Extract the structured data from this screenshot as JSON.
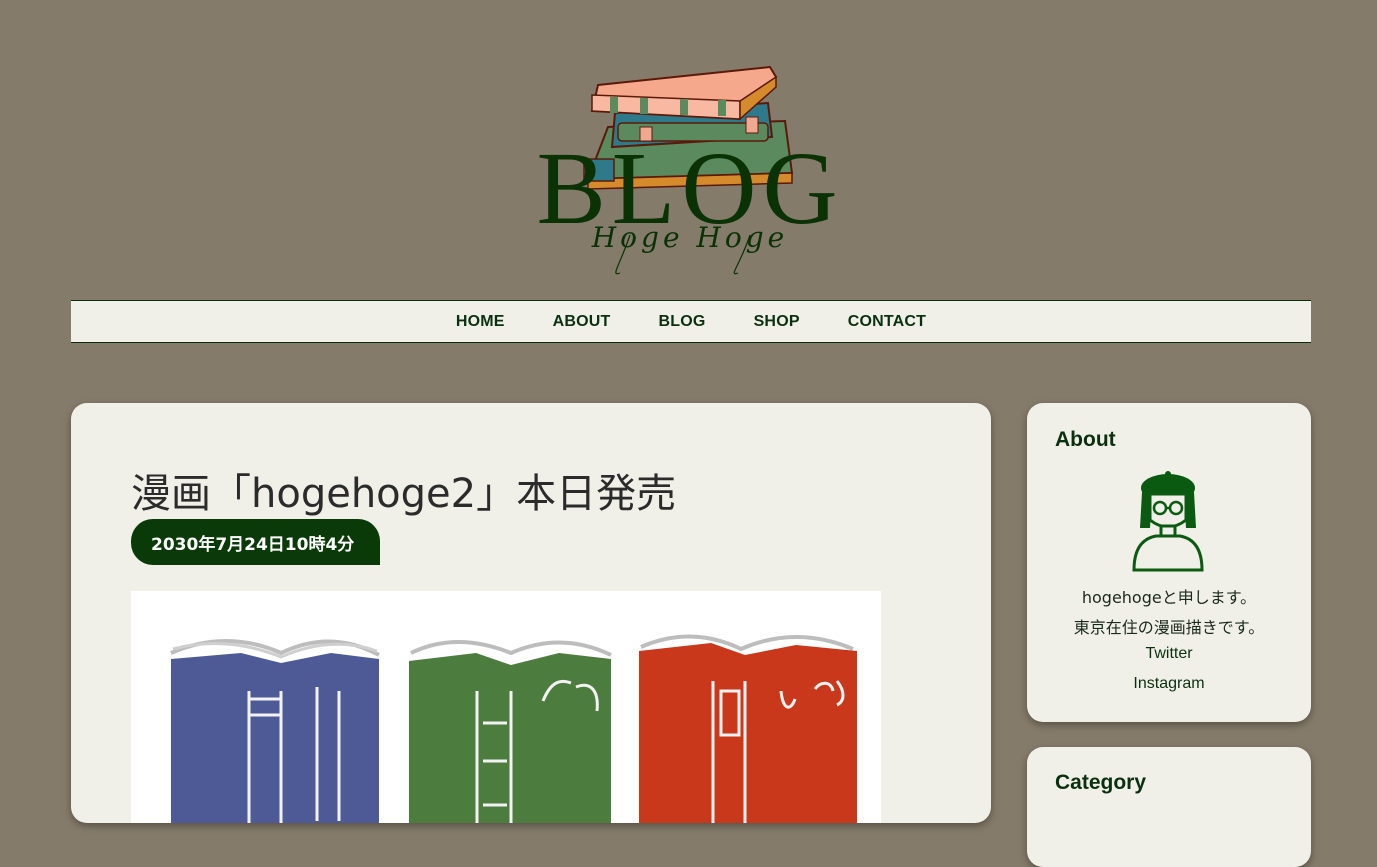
{
  "logo": {
    "title": "BLOG",
    "subtitle": "Hoge Hoge"
  },
  "nav": {
    "items": [
      "HOME",
      "ABOUT",
      "BLOG",
      "SHOP",
      "CONTACT"
    ]
  },
  "post": {
    "title": "漫画「hogehoge2」本日発売",
    "date": "2030年7月24日10時4分"
  },
  "sidebar": {
    "about": {
      "title": "About",
      "line1": "hogehogeと申します。",
      "line2": "東京在住の漫画描きです。",
      "twitter": "Twitter",
      "instagram": "Instagram"
    },
    "category": {
      "title": "Category"
    }
  },
  "colors": {
    "background": "#857b6a",
    "card": "#f1f0e8",
    "accent_green": "#0a3a08",
    "book_blue": "#4e5a96",
    "book_green": "#4c7c3e",
    "book_red": "#c9381a"
  }
}
